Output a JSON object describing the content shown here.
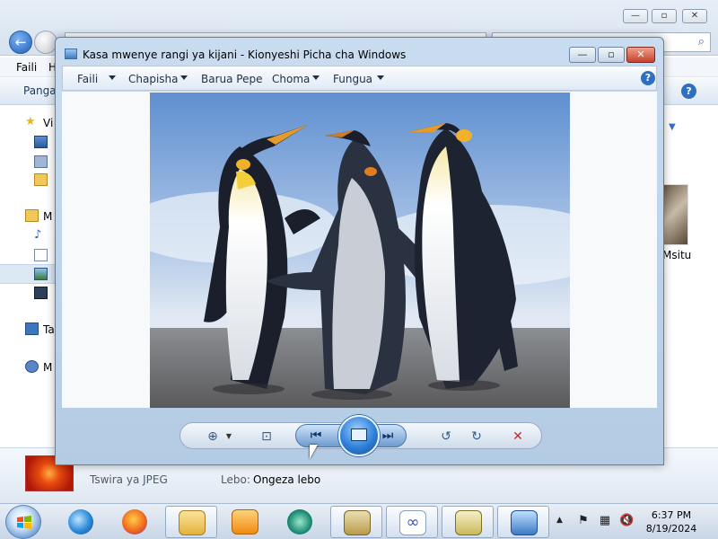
{
  "explorer": {
    "menu": {
      "file": "Faili",
      "h": "H"
    },
    "toolbar": {
      "organize": "Panga",
      "help": "?"
    },
    "nav": [
      {
        "label": "Vi",
        "icon": "star"
      },
      {
        "label": "",
        "icon": "desktop"
      },
      {
        "label": "",
        "icon": "downloads"
      },
      {
        "label": "",
        "icon": "recent"
      },
      {
        "label": "M",
        "icon": "libraries"
      },
      {
        "label": "",
        "icon": "music"
      },
      {
        "label": "",
        "icon": "documents"
      },
      {
        "label": "",
        "icon": "pictures"
      },
      {
        "label": "",
        "icon": "videos"
      },
      {
        "label": "Ta",
        "icon": "homegroup"
      },
      {
        "label": "M",
        "icon": "network"
      }
    ],
    "thumb_label": "Msitu",
    "details": {
      "file_type": "Tswira ya JPEG",
      "tags_label": "Lebo:",
      "tags_value": "Ongeza lebo"
    }
  },
  "viewer": {
    "title": "Kasa mwenye rangi ya kijani - Kionyeshi Picha cha Windows",
    "menu": {
      "file": "Faili",
      "print": "Chapisha",
      "email": "Barua Pepe",
      "burn": "Choma",
      "open": "Fungua",
      "help": "?"
    },
    "controls": {
      "zoom": "zoom-icon",
      "fit": "fit-window-icon",
      "prev": "previous-icon",
      "slideshow": "slideshow-icon",
      "next": "next-icon",
      "rotate_ccw": "rotate-left-icon",
      "rotate_cw": "rotate-right-icon",
      "delete": "delete-icon"
    }
  },
  "taskbar": {
    "time": "6:37 PM",
    "date": "8/19/2024"
  }
}
